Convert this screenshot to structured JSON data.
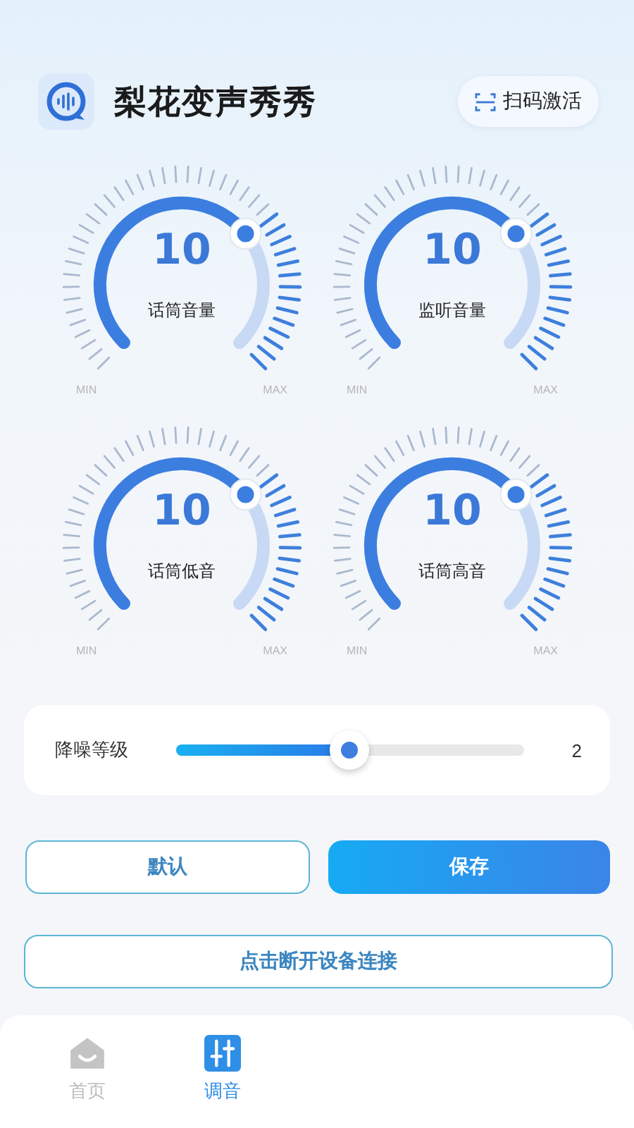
{
  "header": {
    "title": "梨花变声秀秀",
    "scan_button": "扫码激活"
  },
  "dials": [
    {
      "value": "10",
      "label": "话筒音量",
      "min": "MIN",
      "max": "MAX"
    },
    {
      "value": "10",
      "label": "监听音量",
      "min": "MIN",
      "max": "MAX"
    },
    {
      "value": "10",
      "label": "话筒低音",
      "min": "MIN",
      "max": "MAX"
    },
    {
      "value": "10",
      "label": "话筒高音",
      "min": "MIN",
      "max": "MAX"
    }
  ],
  "noise": {
    "label": "降噪等级",
    "level": 0.5,
    "reading": "2"
  },
  "buttons": {
    "default": "默认",
    "save": "保存",
    "disconnect": "点击断开设备连接"
  },
  "tabs": [
    {
      "label": "首页",
      "selected": false
    },
    {
      "label": "调音",
      "selected": true
    }
  ]
}
